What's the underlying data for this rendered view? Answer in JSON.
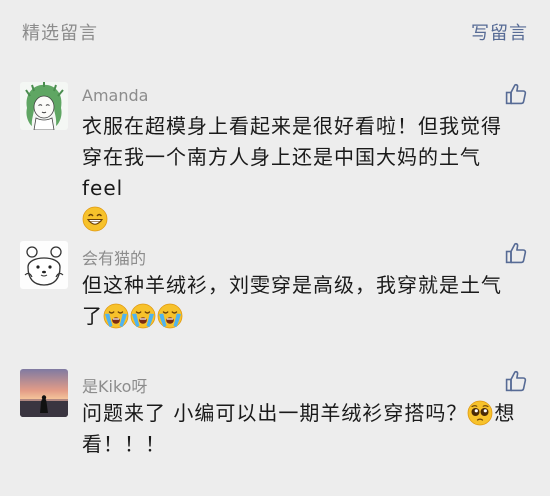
{
  "header": {
    "title": "精选留言",
    "write_label": "写留言"
  },
  "comments": [
    {
      "nickname": "Amanda",
      "avatar_icon": "green-haired-girl-avatar",
      "text": "衣服在超模身上看起来是很好看啦！但我觉得穿在我一个南方人身上还是中国大妈的土气feel",
      "emojis": [
        "grin-emoji"
      ]
    },
    {
      "nickname": "会有猫的",
      "avatar_icon": "bear-face-avatar",
      "text": "但这种羊绒衫，刘雯穿是高级，我穿就是土气了",
      "emojis": [
        "loudly-crying-emoji",
        "loudly-crying-emoji",
        "loudly-crying-emoji"
      ]
    },
    {
      "nickname": "是Kiko呀",
      "avatar_icon": "sunset-photo-avatar",
      "text_before": "问题来了 小编可以出一期羊绒衫穿搭吗？",
      "text_after": "想看！！！",
      "emojis": [
        "pleading-emoji"
      ]
    }
  ],
  "colors": {
    "background": "#ededed",
    "link": "#576b95",
    "meta": "#8c8c8c",
    "text": "#1a1a1a"
  }
}
